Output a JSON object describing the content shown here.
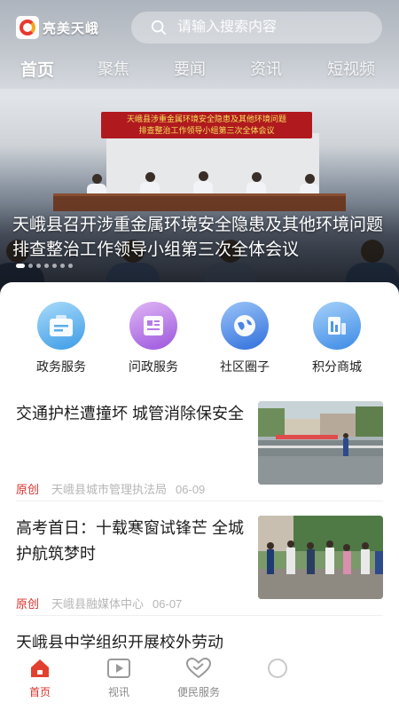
{
  "app": {
    "logo_text": "亮美天峨"
  },
  "search": {
    "placeholder": "请输入搜索内容"
  },
  "tabs": [
    {
      "label": "首页",
      "active": true
    },
    {
      "label": "聚焦"
    },
    {
      "label": "要闻"
    },
    {
      "label": "资讯"
    },
    {
      "label": "短视频"
    }
  ],
  "hero": {
    "banner_line1": "天峨县涉重金属环境安全隐患及其他环境问题",
    "banner_line2": "排查整治工作领导小组第三次全体会议",
    "headline": "天峨县召开涉重金属环境安全隐患及其他环境问题排查整治工作领导小组第三次全体会议",
    "carousel_count": 7,
    "carousel_active": 0
  },
  "services": [
    {
      "label": "政务服务",
      "icon": "government-service-icon",
      "color_from": "#8fd0f7",
      "color_to": "#3d9be6"
    },
    {
      "label": "问政服务",
      "icon": "inquiry-service-icon",
      "color_from": "#d7a3f2",
      "color_to": "#9b55dd"
    },
    {
      "label": "社区圈子",
      "icon": "community-globe-icon",
      "color_from": "#7fb1f5",
      "color_to": "#2f6fdc"
    },
    {
      "label": "积分商城",
      "icon": "points-mall-icon",
      "color_from": "#8ec4f7",
      "color_to": "#3c8ae6"
    }
  ],
  "news": [
    {
      "title": "交通护栏遭撞坏 城管消除保安全",
      "tag": "原创",
      "source": "天峨县城市管理执法局",
      "date": "06-09"
    },
    {
      "title": "高考首日：十载寒窗试锋芒 全城护航筑梦时",
      "tag": "原创",
      "source": "天峨县融媒体中心",
      "date": "06-07"
    },
    {
      "title": "天峨县中学组织开展校外劳动"
    }
  ],
  "bottom_nav": [
    {
      "label": "首页",
      "icon": "home-icon",
      "active": true
    },
    {
      "label": "视讯",
      "icon": "video-icon"
    },
    {
      "label": "便民服务",
      "icon": "convenience-heart-icon"
    },
    {
      "label": "",
      "icon": "more-icon"
    }
  ],
  "colors": {
    "accent": "#d9322b",
    "tag_red": "#d9322b"
  }
}
